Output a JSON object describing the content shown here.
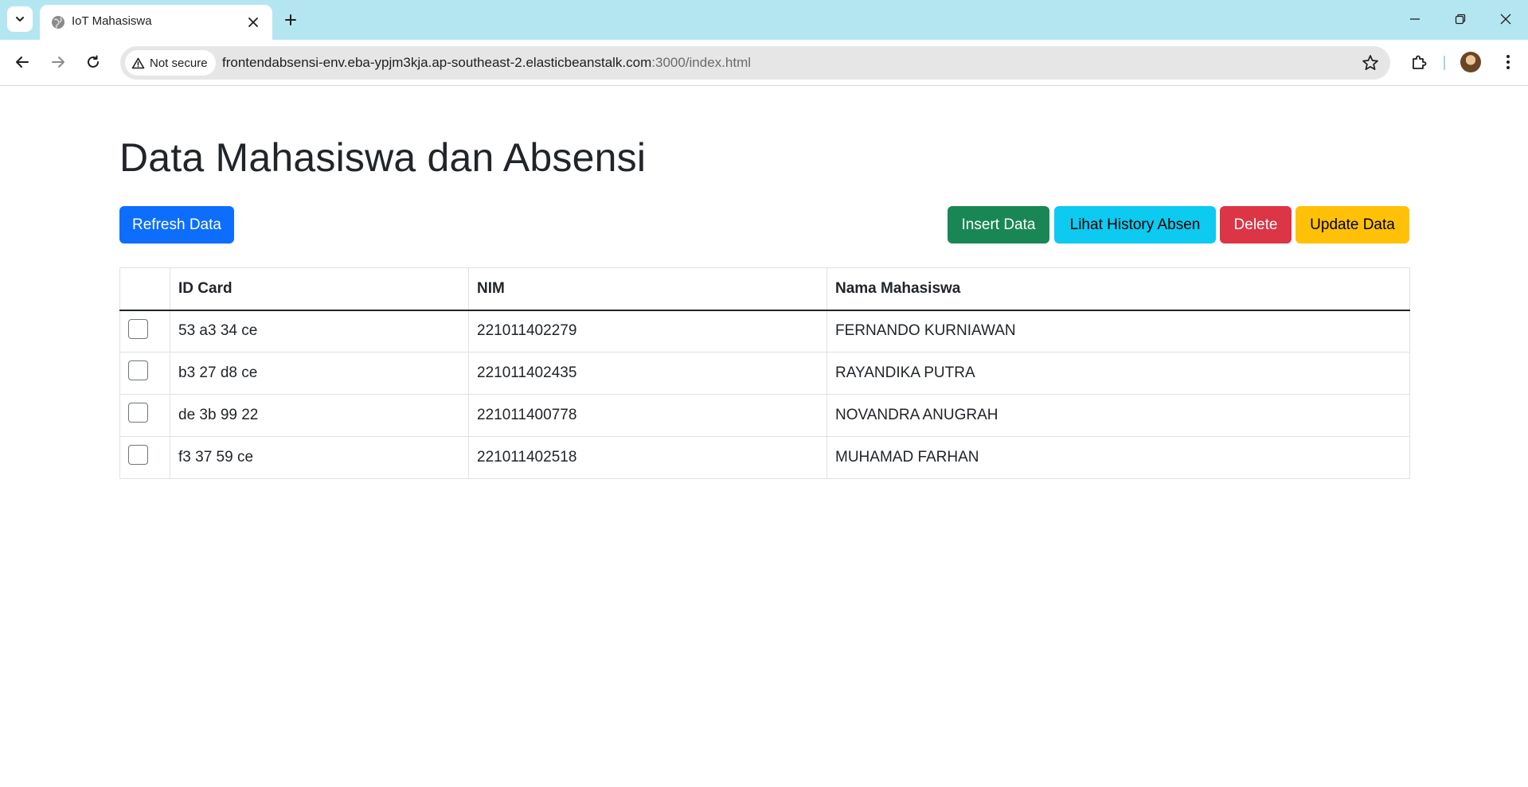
{
  "browser": {
    "tab_title": "IoT Mahasiswa",
    "security_label": "Not secure",
    "url_host": "frontendabsensi-env.eba-ypjm3kja.ap-southeast-2.elasticbeanstalk.com",
    "url_path": ":3000/index.html"
  },
  "page": {
    "title": "Data Mahasiswa dan Absensi"
  },
  "actions": {
    "refresh": "Refresh Data",
    "insert": "Insert Data",
    "history": "Lihat History Absen",
    "delete": "Delete",
    "update": "Update Data"
  },
  "colors": {
    "primary": "#0d6efd",
    "success": "#198754",
    "info": "#0dcaf0",
    "danger": "#dc3545",
    "warning": "#ffc107",
    "tabbar": "#b4e6f2"
  },
  "table": {
    "headers": [
      "",
      "ID Card",
      "NIM",
      "Nama Mahasiswa"
    ],
    "rows": [
      {
        "checked": false,
        "id_card": "53 a3 34 ce",
        "nim": "221011402279",
        "nama": "FERNANDO KURNIAWAN"
      },
      {
        "checked": false,
        "id_card": "b3 27 d8 ce",
        "nim": "221011402435",
        "nama": "RAYANDIKA PUTRA"
      },
      {
        "checked": false,
        "id_card": "de 3b 99 22",
        "nim": "221011400778",
        "nama": "NOVANDRA ANUGRAH"
      },
      {
        "checked": false,
        "id_card": "f3 37 59 ce",
        "nim": "221011402518",
        "nama": "MUHAMAD FARHAN"
      }
    ]
  }
}
